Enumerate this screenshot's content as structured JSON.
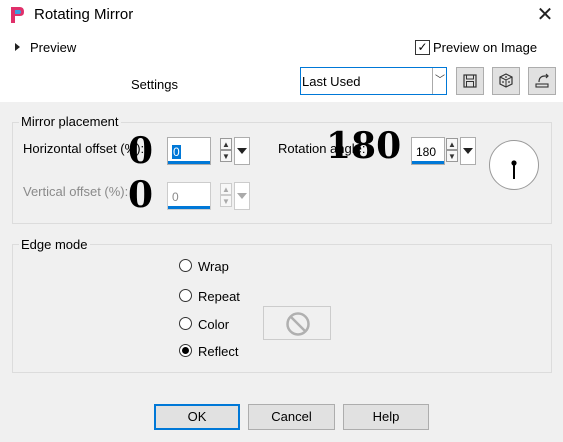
{
  "window": {
    "title": "Rotating Mirror"
  },
  "header": {
    "preview_label": "Preview",
    "preview_on_image_label": "Preview on Image",
    "preview_on_image_checked": true,
    "settings_label": "Settings",
    "preset_value": "Last Used"
  },
  "mirror_placement": {
    "legend": "Mirror placement",
    "horizontal_label": "Horizontal offset (%):",
    "horizontal_value": "0",
    "horizontal_big": "0",
    "vertical_label": "Vertical offset (%):",
    "vertical_value": "0",
    "vertical_big": "0",
    "rotation_label": "Rotation angle:",
    "rotation_value": "180",
    "rotation_big": "180"
  },
  "edge_mode": {
    "legend": "Edge mode",
    "options": [
      "Wrap",
      "Repeat",
      "Color",
      "Reflect"
    ],
    "selected": "Reflect"
  },
  "buttons": {
    "ok": "OK",
    "cancel": "Cancel",
    "help": "Help"
  }
}
